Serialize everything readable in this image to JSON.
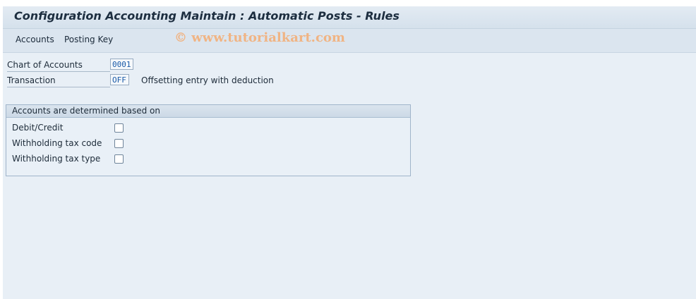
{
  "window": {
    "title": "Configuration Accounting Maintain : Automatic Posts - Rules"
  },
  "menu": {
    "items": [
      {
        "label": "Accounts"
      },
      {
        "label": "Posting Key"
      }
    ]
  },
  "watermark": "© www.tutorialkart.com",
  "fields": {
    "chart_of_accounts": {
      "label": "Chart of Accounts",
      "value": "0001"
    },
    "transaction": {
      "label": "Transaction",
      "value": "OFF",
      "description": "Offsetting entry with deduction"
    }
  },
  "group": {
    "title": "Accounts are determined based on",
    "options": [
      {
        "label": "Debit/Credit",
        "checked": false
      },
      {
        "label": "Withholding tax code",
        "checked": false
      },
      {
        "label": "Withholding tax type",
        "checked": false
      }
    ]
  },
  "colors": {
    "background": "#e8eff6",
    "field_value_text": "#1a5aa8",
    "watermark": "#f0b484"
  }
}
